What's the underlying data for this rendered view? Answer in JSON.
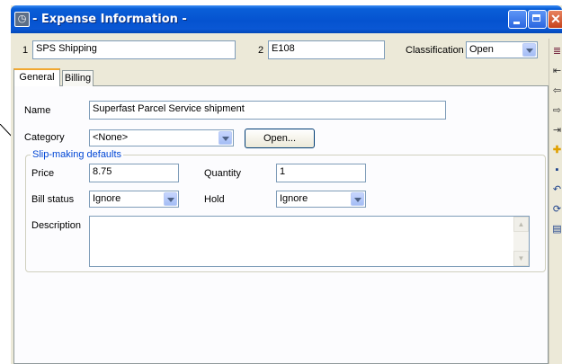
{
  "window": {
    "title": "- Expense Information -",
    "close_glyph": "✕"
  },
  "header": {
    "row1_number": "1",
    "row1_value": "SPS Shipping",
    "row2_number": "2",
    "row2_value": "E108",
    "classification_label": "Classification",
    "classification_value": "Open"
  },
  "tabs": [
    {
      "label": "General"
    },
    {
      "label": "Billing"
    }
  ],
  "general": {
    "name_label": "Name",
    "name_value": "Superfast Parcel Service shipment",
    "category_label": "Category",
    "category_value": "<None>",
    "open_button_label": "Open..."
  },
  "slip_defaults": {
    "legend": "Slip-making defaults",
    "price_label": "Price",
    "price_value": "8.75",
    "quantity_label": "Quantity",
    "quantity_value": "1",
    "bill_status_label": "Bill status",
    "bill_status_value": "Ignore",
    "hold_label": "Hold",
    "hold_value": "Ignore",
    "description_label": "Description",
    "description_value": ""
  },
  "toolbar_icons": [
    "list-icon",
    "first-record-icon",
    "previous-record-icon",
    "next-record-icon",
    "last-record-icon",
    "new-record-icon",
    "save-icon",
    "undo-icon",
    "refresh-icon",
    "report-icon"
  ],
  "colors": {
    "titlebar": "#0553d0",
    "legend": "#0046d5",
    "tab_accent": "#f1a830"
  }
}
